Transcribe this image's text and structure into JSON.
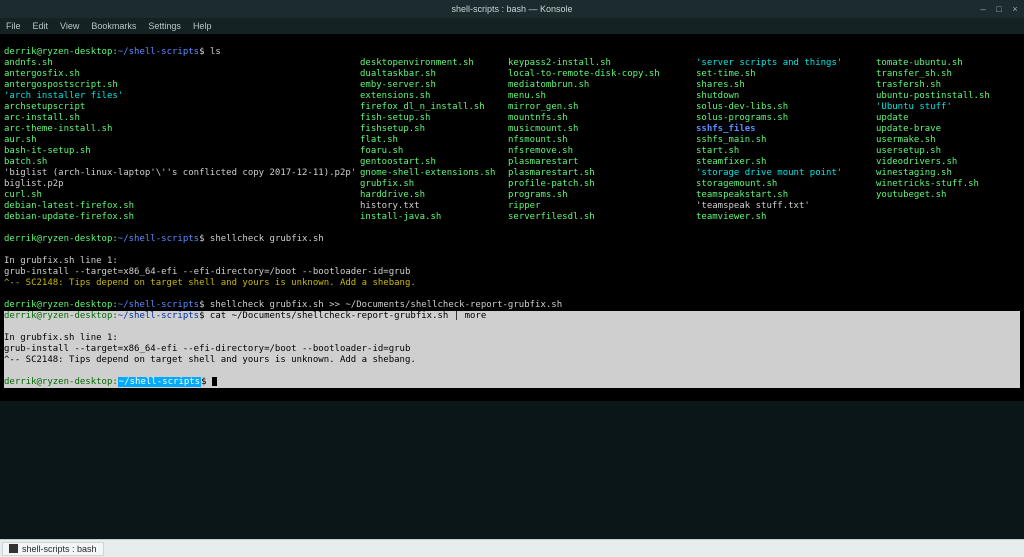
{
  "window": {
    "title": "shell-scripts : bash — Konsole",
    "controls": {
      "min": "–",
      "max": "□",
      "close": "×"
    }
  },
  "menu": {
    "items": [
      "File",
      "Edit",
      "View",
      "Bookmarks",
      "Settings",
      "Help"
    ]
  },
  "prompt": {
    "user": "derrik@ryzen-desktop",
    "sep": ":",
    "cwd": "~/shell-scripts",
    "sigil": "$"
  },
  "commands": {
    "ls": "ls",
    "sc1": "shellcheck grubfix.sh",
    "sc2": "shellcheck grubfix.sh >> ~/Documents/shellcheck-report-grubfix.sh",
    "cat": "cat ~/Documents/shellcheck-report-grubfix.sh | more"
  },
  "ls": {
    "c1": [
      {
        "t": "andnfs.sh",
        "c": "f-exec"
      },
      {
        "t": "antergosfix.sh",
        "c": "f-exec"
      },
      {
        "t": "antergospostscript.sh",
        "c": "f-exec"
      },
      {
        "t": "'arch installer files'",
        "c": "f-quoted"
      },
      {
        "t": "archsetupscript",
        "c": "f-exec"
      },
      {
        "t": "arc-install.sh",
        "c": "f-exec"
      },
      {
        "t": "arc-theme-install.sh",
        "c": "f-exec"
      },
      {
        "t": "aur.sh",
        "c": "f-exec"
      },
      {
        "t": "bash-it-setup.sh",
        "c": "f-exec"
      },
      {
        "t": "batch.sh",
        "c": "f-exec"
      },
      {
        "t": "'biglist (arch-linux-laptop'\\''s conflicted copy 2017-12-11).p2p'",
        "c": "f-txt"
      },
      {
        "t": "biglist.p2p",
        "c": "f-txt"
      },
      {
        "t": "curl.sh",
        "c": "f-exec"
      },
      {
        "t": "debian-latest-firefox.sh",
        "c": "f-exec"
      },
      {
        "t": "debian-update-firefox.sh",
        "c": "f-exec"
      }
    ],
    "c2": [
      {
        "t": "desktopenvironment.sh",
        "c": "f-exec"
      },
      {
        "t": "dualtaskbar.sh",
        "c": "f-exec"
      },
      {
        "t": "emby-server.sh",
        "c": "f-exec"
      },
      {
        "t": "extensions.sh",
        "c": "f-exec"
      },
      {
        "t": "firefox_dl_n_install.sh",
        "c": "f-exec"
      },
      {
        "t": "fish-setup.sh",
        "c": "f-exec"
      },
      {
        "t": "fishsetup.sh",
        "c": "f-exec"
      },
      {
        "t": "flat.sh",
        "c": "f-exec"
      },
      {
        "t": "foaru.sh",
        "c": "f-exec"
      },
      {
        "t": "gentoostart.sh",
        "c": "f-exec"
      },
      {
        "t": "gnome-shell-extensions.sh",
        "c": "f-exec"
      },
      {
        "t": "grubfix.sh",
        "c": "f-exec"
      },
      {
        "t": "harddrive.sh",
        "c": "f-exec"
      },
      {
        "t": "history.txt",
        "c": "f-txt"
      },
      {
        "t": "install-java.sh",
        "c": "f-exec"
      }
    ],
    "c3": [
      {
        "t": "keypass2-install.sh",
        "c": "f-exec"
      },
      {
        "t": "local-to-remote-disk-copy.sh",
        "c": "f-exec"
      },
      {
        "t": "mediatombrun.sh",
        "c": "f-exec"
      },
      {
        "t": "menu.sh",
        "c": "f-exec"
      },
      {
        "t": "mirror_gen.sh",
        "c": "f-exec"
      },
      {
        "t": "mountnfs.sh",
        "c": "f-exec"
      },
      {
        "t": "musicmount.sh",
        "c": "f-exec"
      },
      {
        "t": "nfsmount.sh",
        "c": "f-exec"
      },
      {
        "t": "nfsremove.sh",
        "c": "f-exec"
      },
      {
        "t": "plasmarestart",
        "c": "f-exec"
      },
      {
        "t": "plasmarestart.sh",
        "c": "f-exec"
      },
      {
        "t": "profile-patch.sh",
        "c": "f-exec"
      },
      {
        "t": "programs.sh",
        "c": "f-exec"
      },
      {
        "t": "ripper",
        "c": "f-exec"
      },
      {
        "t": "serverfilesdl.sh",
        "c": "f-exec"
      }
    ],
    "c4": [
      {
        "t": "'server scripts and things'",
        "c": "f-quoted"
      },
      {
        "t": "set-time.sh",
        "c": "f-exec"
      },
      {
        "t": "shares.sh",
        "c": "f-exec"
      },
      {
        "t": "shutdown",
        "c": "f-exec"
      },
      {
        "t": "solus-dev-libs.sh",
        "c": "f-exec"
      },
      {
        "t": "solus-programs.sh",
        "c": "f-exec"
      },
      {
        "t": "sshfs_files",
        "c": "f-dir"
      },
      {
        "t": "sshfs_main.sh",
        "c": "f-exec"
      },
      {
        "t": "start.sh",
        "c": "f-exec"
      },
      {
        "t": "steamfixer.sh",
        "c": "f-exec"
      },
      {
        "t": "'storage drive mount point'",
        "c": "f-quoted"
      },
      {
        "t": "storagemount.sh",
        "c": "f-exec"
      },
      {
        "t": "teamspeakstart.sh",
        "c": "f-exec"
      },
      {
        "t": "'teamspeak stuff.txt'",
        "c": "f-txt"
      },
      {
        "t": "teamviewer.sh",
        "c": "f-exec"
      }
    ],
    "c5": [
      {
        "t": "tomate-ubuntu.sh",
        "c": "f-exec"
      },
      {
        "t": "transfer_sh.sh",
        "c": "f-exec"
      },
      {
        "t": "trasfersh.sh",
        "c": "f-exec"
      },
      {
        "t": "ubuntu-postinstall.sh",
        "c": "f-exec"
      },
      {
        "t": "'Ubuntu stuff'",
        "c": "f-quoted"
      },
      {
        "t": "update",
        "c": "f-exec"
      },
      {
        "t": "update-brave",
        "c": "f-exec"
      },
      {
        "t": "usermake.sh",
        "c": "f-exec"
      },
      {
        "t": "usersetup.sh",
        "c": "f-exec"
      },
      {
        "t": "videodrivers.sh",
        "c": "f-exec"
      },
      {
        "t": "winestaging.sh",
        "c": "f-exec"
      },
      {
        "t": "winetricks-stuff.sh",
        "c": "f-exec"
      },
      {
        "t": "youtubeget.sh",
        "c": "f-exec"
      }
    ]
  },
  "sc_out": {
    "a": "In grubfix.sh line 1:",
    "b": "grub-install --target=x86_64-efi --efi-directory=/boot --bootloader-id=grub",
    "c": "^-- SC2148: Tips depend on target shell and yours is unknown. Add a shebang."
  },
  "taskbar": {
    "item": "shell-scripts : bash"
  }
}
